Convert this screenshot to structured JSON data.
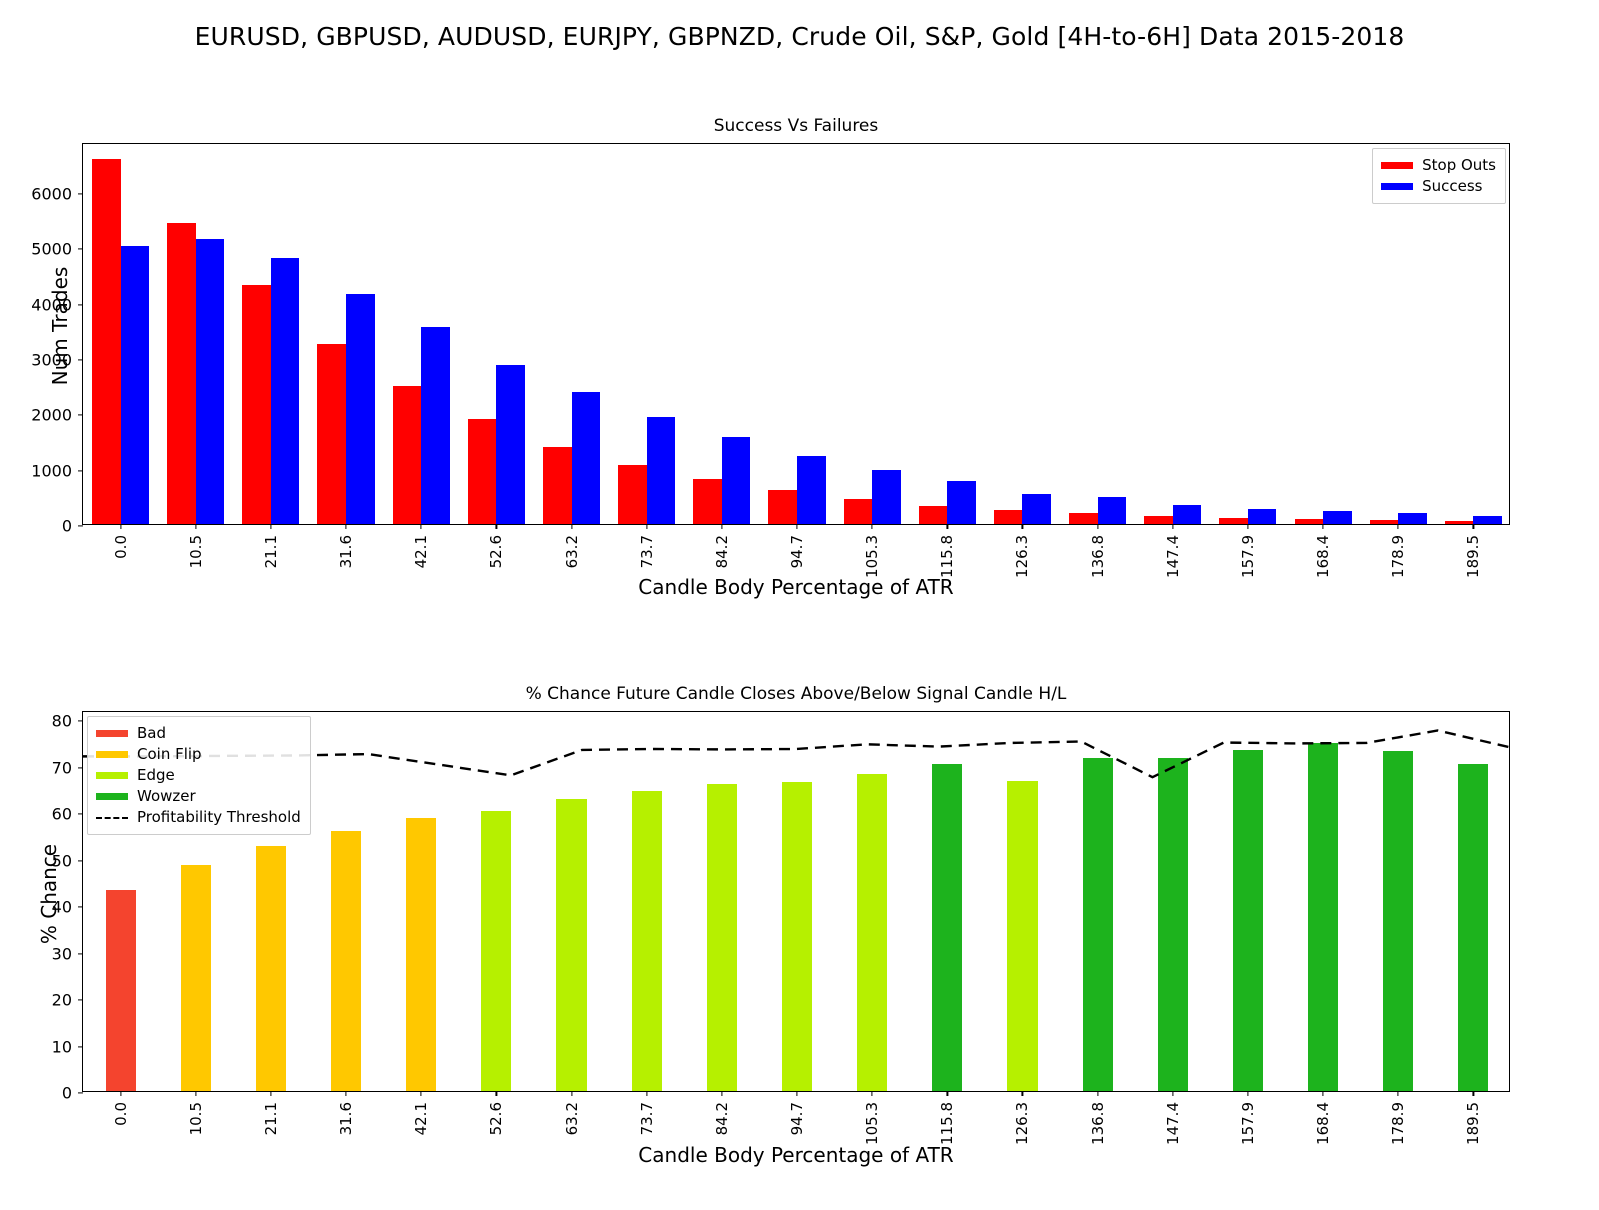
{
  "figure": {
    "title": "EURUSD, GBPUSD, AUDUSD, EURJPY, GBPNZD, Crude Oil, S&P, Gold [4H-to-6H] Data 2015-2018"
  },
  "colors": {
    "stop_outs": "#FF0000",
    "success": "#0000FF",
    "bad": "#F4442E",
    "coin_flip": "#FFC800",
    "edge": "#B6F000",
    "wowzer": "#1DB31D",
    "threshold": "#000000"
  },
  "chart_data": [
    {
      "type": "bar",
      "id": "success-vs-failures",
      "title": "Success Vs Failures",
      "xlabel": "Candle Body Percentage of ATR",
      "ylabel": "Num Trades",
      "ylim": [
        0,
        6900
      ],
      "yticks": [
        0,
        1000,
        2000,
        3000,
        4000,
        5000,
        6000
      ],
      "grid": false,
      "legend_position": "upper right",
      "categories": [
        "0.0",
        "10.5",
        "21.1",
        "31.6",
        "42.1",
        "52.6",
        "63.2",
        "73.7",
        "84.2",
        "94.7",
        "105.3",
        "115.8",
        "126.3",
        "136.8",
        "147.4",
        "157.9",
        "168.4",
        "178.9",
        "189.5"
      ],
      "series": [
        {
          "name": "Stop Outs",
          "color": "#FF0000",
          "values": [
            6600,
            5430,
            4310,
            3260,
            2500,
            1890,
            1400,
            1060,
            810,
            610,
            450,
            330,
            260,
            190,
            140,
            105,
            85,
            70,
            60
          ]
        },
        {
          "name": "Success",
          "color": "#0000FF",
          "values": [
            5020,
            5140,
            4810,
            4160,
            3550,
            2880,
            2380,
            1930,
            1570,
            1220,
            970,
            780,
            540,
            480,
            350,
            280,
            240,
            190,
            150
          ]
        }
      ]
    },
    {
      "type": "bar",
      "id": "chance-future-candle-closes",
      "title": "% Chance Future Candle Closes Above/Below Signal Candle H/L",
      "xlabel": "Candle Body Percentage of ATR",
      "ylabel": "% Chance",
      "ylim": [
        0,
        82
      ],
      "yticks": [
        0,
        10,
        20,
        30,
        40,
        50,
        60,
        70,
        80
      ],
      "grid": false,
      "legend_position": "upper left",
      "categories": [
        "0.0",
        "10.5",
        "21.1",
        "31.6",
        "42.1",
        "52.6",
        "63.2",
        "73.7",
        "84.2",
        "94.7",
        "105.3",
        "115.8",
        "126.3",
        "136.8",
        "147.4",
        "157.9",
        "168.4",
        "178.9",
        "189.5"
      ],
      "values": [
        43.2,
        48.6,
        52.8,
        55.9,
        58.7,
        60.2,
        62.8,
        64.5,
        66.0,
        66.4,
        68.3,
        70.4,
        66.7,
        71.7,
        71.6,
        73.4,
        74.8,
        73.2,
        70.4
      ],
      "bar_classes": [
        "bad",
        "coin_flip",
        "coin_flip",
        "coin_flip",
        "coin_flip",
        "edge",
        "edge",
        "edge",
        "edge",
        "edge",
        "edge",
        "wowzer",
        "edge",
        "wowzer",
        "wowzer",
        "wowzer",
        "wowzer",
        "wowzer",
        "wowzer"
      ],
      "series": [
        {
          "name": "Profitability Threshold",
          "style": "dashed",
          "color": "#000000",
          "values": [
            72.4,
            72.4,
            72.5,
            72.6,
            72.9,
            70.6,
            68.3,
            73.8,
            74.0,
            73.9,
            74.0,
            75.0,
            74.5,
            75.3,
            75.6,
            67.9,
            75.4,
            75.2,
            75.3,
            78.0,
            74.4
          ]
        }
      ],
      "legend_entries": [
        {
          "label": "Bad",
          "color": "#F4442E",
          "style": "swatch"
        },
        {
          "label": "Coin Flip",
          "color": "#FFC800",
          "style": "swatch"
        },
        {
          "label": "Edge",
          "color": "#B6F000",
          "style": "swatch"
        },
        {
          "label": "Wowzer",
          "color": "#1DB31D",
          "style": "swatch"
        },
        {
          "label": "Profitability Threshold",
          "color": "#000000",
          "style": "dashed"
        }
      ]
    }
  ]
}
